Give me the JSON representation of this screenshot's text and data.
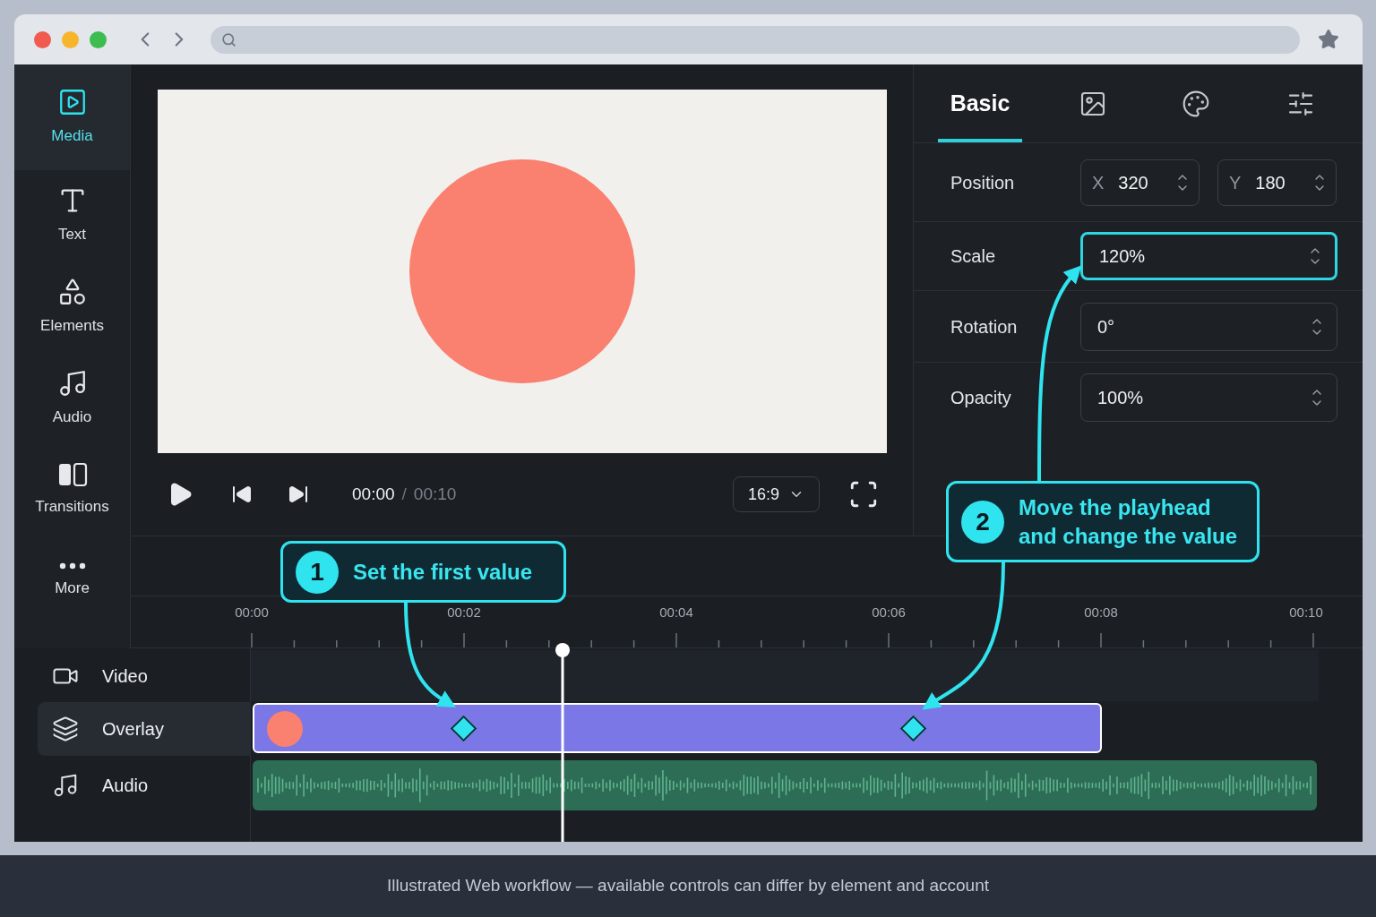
{
  "sidebar": {
    "items": [
      {
        "kind": "media",
        "label": "Media",
        "selected": true
      },
      {
        "kind": "text",
        "label": "Text",
        "selected": false
      },
      {
        "kind": "elements",
        "label": "Elements",
        "selected": false
      },
      {
        "kind": "audio",
        "label": "Audio",
        "selected": false
      },
      {
        "kind": "transitions",
        "label": "Transitions",
        "selected": false
      },
      {
        "kind": "more",
        "label": "More",
        "selected": false
      }
    ]
  },
  "preview": {
    "current_time": "00:00",
    "separator": "/",
    "total_time": "00:10",
    "aspect_ratio": "16:9"
  },
  "inspector": {
    "tabs": [
      {
        "kind": "text",
        "label": "Basic",
        "selected": true
      },
      {
        "kind": "image",
        "selected": false
      },
      {
        "kind": "palette",
        "selected": false
      },
      {
        "kind": "sliders",
        "selected": false
      }
    ],
    "properties": [
      {
        "kind": "xy",
        "label": "Position",
        "fields": [
          {
            "axis": "X",
            "value": "320"
          },
          {
            "axis": "Y",
            "value": "180"
          }
        ]
      },
      {
        "kind": "single",
        "label": "Scale",
        "value": "120%",
        "focused": true
      },
      {
        "kind": "single",
        "label": "Rotation",
        "value": "0°",
        "focused": false
      },
      {
        "kind": "single",
        "label": "Opacity",
        "value": "100%",
        "focused": false
      }
    ]
  },
  "callouts": [
    {
      "number": "1",
      "lines": [
        "Set the first value"
      ]
    },
    {
      "number": "2",
      "lines": [
        "Move the playhead",
        "and change the value"
      ]
    }
  ],
  "timeline": {
    "ruler": [
      "00:00",
      "00:02",
      "00:04",
      "00:06",
      "00:08",
      "00:10"
    ],
    "playhead": {
      "level": 0.293
    },
    "tracks": [
      {
        "kind": "video",
        "label": "Video",
        "selected": false
      },
      {
        "kind": "overlay",
        "label": "Overlay",
        "selected": true
      },
      {
        "kind": "audio",
        "label": "Audio",
        "selected": false
      }
    ]
  },
  "footer": "Illustrated Web workflow — available controls can differ by element and account"
}
